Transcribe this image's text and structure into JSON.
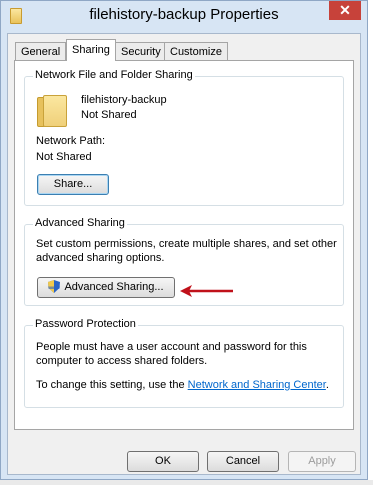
{
  "window": {
    "title": "filehistory-backup Properties",
    "close_glyph": "✕"
  },
  "tabs": [
    {
      "label": "General",
      "active": false
    },
    {
      "label": "Sharing",
      "active": true
    },
    {
      "label": "Security",
      "active": false
    },
    {
      "label": "Customize",
      "active": false
    }
  ],
  "network_sharing": {
    "group_label": "Network File and Folder Sharing",
    "folder_name": "filehistory-backup",
    "share_status": "Not Shared",
    "network_path_label": "Network Path:",
    "network_path_value": "Not Shared",
    "share_button": "Share..."
  },
  "advanced_sharing": {
    "group_label": "Advanced Sharing",
    "description": "Set custom permissions, create multiple shares, and set other advanced sharing options.",
    "description_line1": "Set custom permissions, create multiple shares, and set other",
    "description_line2": "advanced sharing options.",
    "button": "Advanced Sharing..."
  },
  "password_protection": {
    "group_label": "Password Protection",
    "line1": "People must have a user account and password for this",
    "line2": "computer to access shared folders.",
    "change_text": "To change this setting, use the ",
    "link": "Network and Sharing Center",
    "period": "."
  },
  "footer": {
    "ok": "OK",
    "cancel": "Cancel",
    "apply": "Apply"
  },
  "colors": {
    "accent": "#0066cc",
    "arrow": "#c0111a",
    "close": "#c7423a"
  }
}
